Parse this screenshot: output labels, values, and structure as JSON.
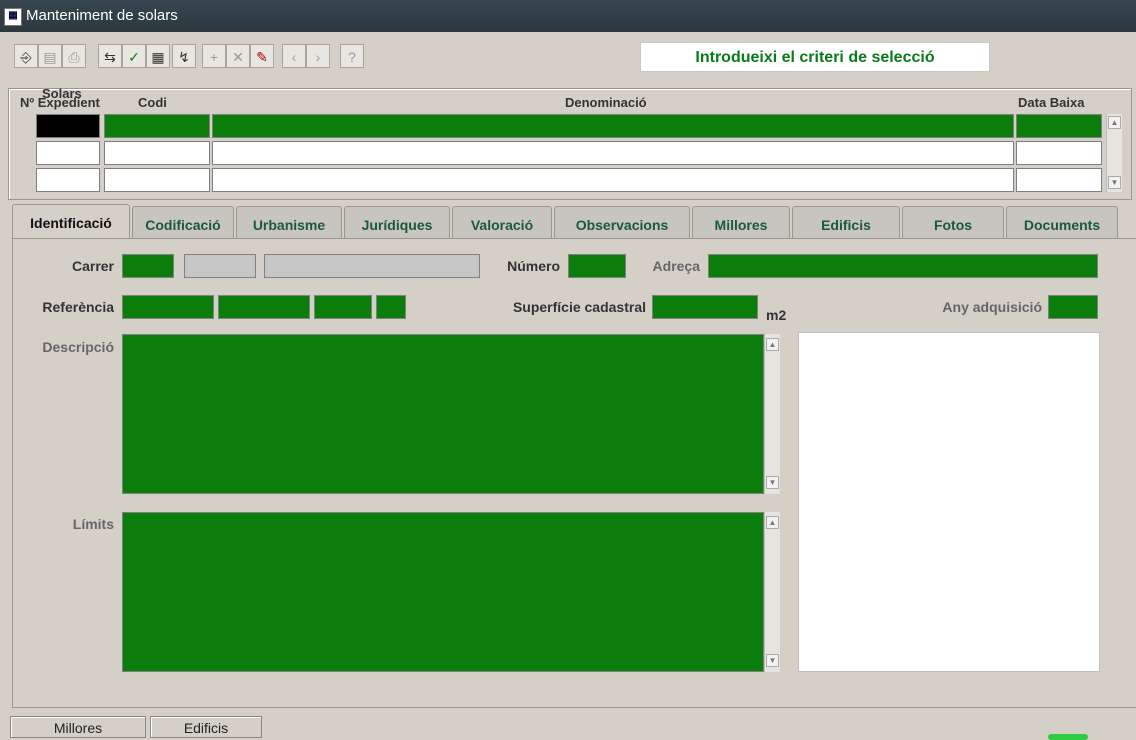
{
  "window": {
    "title": "Manteniment de solars"
  },
  "toolbar": {
    "criteria_text": "Introdueixi el criteri de selecció",
    "buttons": [
      {
        "name": "exit",
        "glyph": "⎆"
      },
      {
        "name": "save",
        "glyph": "▤"
      },
      {
        "name": "print",
        "glyph": "⎙"
      },
      {
        "name": "enter-query",
        "glyph": "⇆"
      },
      {
        "name": "execute-query",
        "glyph": "✓"
      },
      {
        "name": "count-query",
        "glyph": "▦"
      },
      {
        "name": "cancel-query",
        "glyph": "↯"
      },
      {
        "name": "insert-record",
        "glyph": "+"
      },
      {
        "name": "delete-record",
        "glyph": "✕"
      },
      {
        "name": "edit",
        "glyph": "✎"
      },
      {
        "name": "previous",
        "glyph": "‹"
      },
      {
        "name": "next",
        "glyph": "›"
      },
      {
        "name": "help",
        "glyph": "?"
      }
    ]
  },
  "solars": {
    "block_title": "Solars",
    "columns": {
      "expedient": "Nº Expedient",
      "codi": "Codi",
      "denominacio": "Denominació",
      "data_baixa": "Data Baixa"
    }
  },
  "tabs": [
    {
      "label": "Identificació",
      "active": true
    },
    {
      "label": "Codificació",
      "active": false
    },
    {
      "label": "Urbanisme",
      "active": false
    },
    {
      "label": "Jurídiques",
      "active": false
    },
    {
      "label": "Valoració",
      "active": false
    },
    {
      "label": "Observacions",
      "active": false
    },
    {
      "label": "Millores",
      "active": false
    },
    {
      "label": "Edificis",
      "active": false
    },
    {
      "label": "Fotos",
      "active": false
    },
    {
      "label": "Documents",
      "active": false
    }
  ],
  "form": {
    "carrer": "Carrer",
    "numero": "Número",
    "adreca": "Adreça",
    "referencia": "Referència",
    "superficie": "Superfície cadastral",
    "unit_m2": "m2",
    "any_adquisicio": "Any adquisició",
    "descripcio": "Descripció",
    "limits": "Límits"
  },
  "bottom_buttons": {
    "millores": "Millores",
    "edificis": "Edificis"
  },
  "colors": {
    "field_green": "#0a7d0a",
    "criteria_text": "#0a7a1a",
    "titlebar": "#2b3840"
  }
}
